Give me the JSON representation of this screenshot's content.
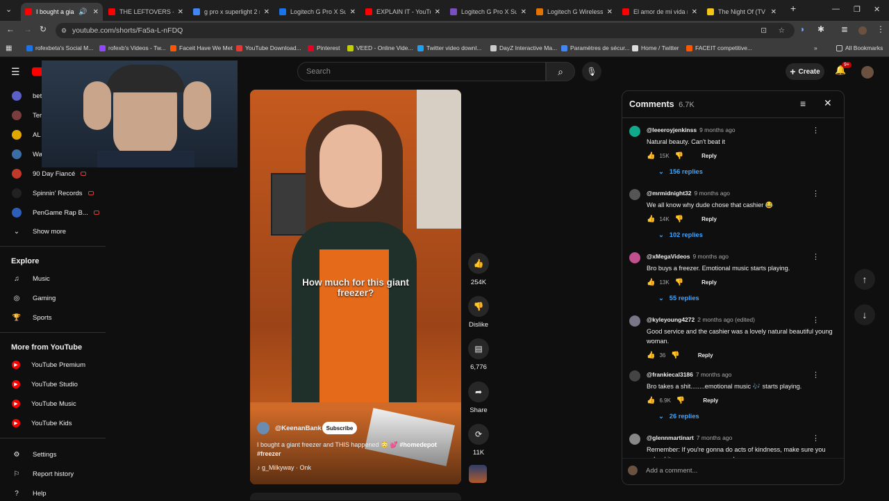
{
  "browser": {
    "tabs": [
      {
        "title": "I bought a giant f",
        "color": "#ff0000",
        "active": true
      },
      {
        "title": "THE LEFTOVERS - Se",
        "color": "#ff0000"
      },
      {
        "title": "g pro x superlight 2 m",
        "color": "#4285f4"
      },
      {
        "title": "Logitech G Pro X Sup",
        "color": "#1a73e8"
      },
      {
        "title": "EXPLAIN IT - YouTub",
        "color": "#ff0000"
      },
      {
        "title": "Logitech G Pro X Sup",
        "color": "#7a4fbf"
      },
      {
        "title": "Logitech G Wireless",
        "color": "#e37400"
      },
      {
        "title": "El amor de mi vida m",
        "color": "#ff0000"
      },
      {
        "title": "The Night Of (TV Min",
        "color": "#f5c518"
      }
    ],
    "url": "youtube.com/shorts/Fa5a-L-nFDQ",
    "bookmarks": [
      {
        "label": "rofexbeta's Social M...",
        "color": "#1a73e8"
      },
      {
        "label": "rofexb's Videos - Tw...",
        "color": "#9146ff"
      },
      {
        "label": "Faceit Have We Met",
        "color": "#ff5500"
      },
      {
        "label": "YouTube Download...",
        "color": "#e53935"
      },
      {
        "label": "Pinterest",
        "color": "#e60023"
      },
      {
        "label": "VEED - Online Vide...",
        "color": "#c0d000"
      },
      {
        "label": "Twitter video downl...",
        "color": "#1da1f2"
      },
      {
        "label": "DayZ Interactive Ma...",
        "color": "#cccccc"
      },
      {
        "label": "Paramètres de sécur...",
        "color": "#4285f4"
      },
      {
        "label": "Home / Twitter",
        "color": "#dddddd"
      },
      {
        "label": "FACEIT competitive...",
        "color": "#ff5500"
      }
    ],
    "all_bookmarks": "All Bookmarks"
  },
  "header": {
    "search_placeholder": "Search",
    "create_label": "Create",
    "notification_count": "9+"
  },
  "sidebar": {
    "subscriptions": [
      {
        "label": "bet",
        "color": "#5b5fc7"
      },
      {
        "label": "Ter",
        "color": "#7a3d3d"
      },
      {
        "label": "AL",
        "color": "#e0a800"
      },
      {
        "label": "Wa",
        "color": "#3a6ea5"
      },
      {
        "label": "90 Day Fiancé",
        "color": "#c0392b",
        "live": true
      },
      {
        "label": "Spinnin' Records",
        "color": "#222222",
        "live": true
      },
      {
        "label": "PenGame Rap B...",
        "color": "#2b5fb8",
        "live": true
      }
    ],
    "show_more": "Show more",
    "explore_heading": "Explore",
    "explore": [
      {
        "label": "Music",
        "icon": "music-note-icon"
      },
      {
        "label": "Gaming",
        "icon": "gamepad-icon"
      },
      {
        "label": "Sports",
        "icon": "trophy-icon"
      }
    ],
    "more_heading": "More from YouTube",
    "more": [
      {
        "label": "YouTube Premium"
      },
      {
        "label": "YouTube Studio"
      },
      {
        "label": "YouTube Music"
      },
      {
        "label": "YouTube Kids"
      }
    ],
    "settings": [
      {
        "label": "Settings",
        "icon": "gear-icon"
      },
      {
        "label": "Report history",
        "icon": "flag-icon"
      },
      {
        "label": "Help",
        "icon": "help-icon"
      }
    ]
  },
  "short": {
    "overlay_text": "How much for this giant freezer?",
    "channel": "@KeenanBank",
    "subscribe": "Subscribe",
    "title": "I bought a giant freezer and THIS happened 😳 💕",
    "hashtag1": "#homedepot",
    "hashtag2": "#freezer",
    "sound": "g_Milkyway · Onk",
    "likes": "254K",
    "dislike_label": "Dislike",
    "comments_count": "6,776",
    "share_label": "Share",
    "remix_count": "11K"
  },
  "comments": {
    "title": "Comments",
    "count": "6.7K",
    "add_placeholder": "Add a comment...",
    "items": [
      {
        "handle": "@leeeroyjenkinss",
        "time": "9 months ago",
        "text": "Natural beauty.  Can't beat it",
        "likes": "15K",
        "replies": "156 replies",
        "avatar": "#12a88a"
      },
      {
        "handle": "@mrmidnight32",
        "time": "9 months ago",
        "text": "We all know why dude chose that cashier 😂",
        "likes": "14K",
        "replies": "102 replies",
        "avatar": "#555555"
      },
      {
        "handle": "@xMegaVideos",
        "time": "9 months ago",
        "text": "Bro buys a freezer. Emotional music starts playing.",
        "likes": "13K",
        "replies": "55 replies",
        "avatar": "#c05090"
      },
      {
        "handle": "@kyleyoung4272",
        "time": "2 months ago (edited)",
        "text": "Good service and the cashier was a lovely natural beautiful young woman.",
        "likes": "36",
        "replies": "",
        "avatar": "#777788"
      },
      {
        "handle": "@frankiecal3186",
        "time": "7 months ago",
        "text": "Bro takes a shit........emotional music 🎶 starts playing.",
        "likes": "6.9K",
        "replies": "26 replies",
        "avatar": "#444444"
      },
      {
        "handle": "@glennmartinart",
        "time": "7 months ago",
        "text": "Remember: If you're gonna do acts of kindness, make sure you upload it so everyone can see how generous you are.",
        "likes": "",
        "replies": "",
        "avatar": "#888888"
      }
    ],
    "reply_label": "Reply"
  }
}
